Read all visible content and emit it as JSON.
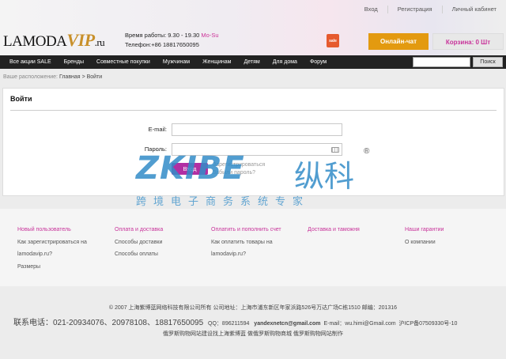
{
  "header": {
    "top_links": [
      "Вход",
      "Регистрация",
      "Личный кабинет"
    ],
    "logo": {
      "main": "LAMODA",
      "vip": "VIP",
      "suffix": ".ru"
    },
    "hours_label": "Время работы: 9.30 - 19.30",
    "hours_days": "Mo-Su",
    "phone": "Телефон:+86 18817650095",
    "sale_icon_text": "sale",
    "chat_button": "Онлайн-чат",
    "cart_button": "Корзина: 0 Шт"
  },
  "nav": {
    "items": [
      "Все акции SALE",
      "Бренды",
      "Совместные покупки",
      "Мужчинам",
      "Женщинам",
      "Детям",
      "Для дома",
      "Форум"
    ],
    "search_value": "",
    "search_button": "Поиск"
  },
  "breadcrumb": {
    "prefix": "Ваше расположение:",
    "home": "Главная",
    "separator": ">",
    "current": "Войти"
  },
  "login": {
    "title": "Войти",
    "email_label": "E-mail:",
    "email_value": "",
    "password_label": "Пароль:",
    "password_value": "",
    "submit": "Вход",
    "register_link": "Зарегистрироваться",
    "forgot_link": "Забыли пароль?"
  },
  "watermark": {
    "main": "ZKIBE",
    "cn": "纵科",
    "reg": "®",
    "sub": "跨境电子商务系统专家"
  },
  "footer": {
    "columns": [
      {
        "head": "Новый пользователь",
        "items": [
          "Как зарегистрироваться на",
          "lamodavip.ru?",
          "Размеры"
        ]
      },
      {
        "head": "Оплата и доставка",
        "items": [
          "Способы доставки",
          "Способы оплаты"
        ]
      },
      {
        "head": "Оплатить и пополнить счет",
        "items": [
          "Как оплатить товары на",
          "lamodavip.ru?"
        ]
      },
      {
        "head": "Доставка и таможня",
        "items": []
      },
      {
        "head": "Наши гарантии",
        "items": [
          "О компании"
        ]
      }
    ],
    "copyright": "© 2007 上海紫博蓝网络科技有限公司所有    公司地址：上海市浦东新区年家浜路526号万达广场C栋1510    邮编：201316",
    "contact_prefix": "联系电话：021-20934076、20978108、18817650095",
    "qq": "QQ：896211594",
    "email_bold": "yandexnetcn@gmail.com",
    "email2": "E-mail：wu.himi@Gmail.com",
    "icp": "沪ICP备07509330号-10",
    "credits": "俄罗斯购物网站建设找上海紫博蓝 做俄罗斯购物商城  俄罗斯购物网站制作"
  }
}
